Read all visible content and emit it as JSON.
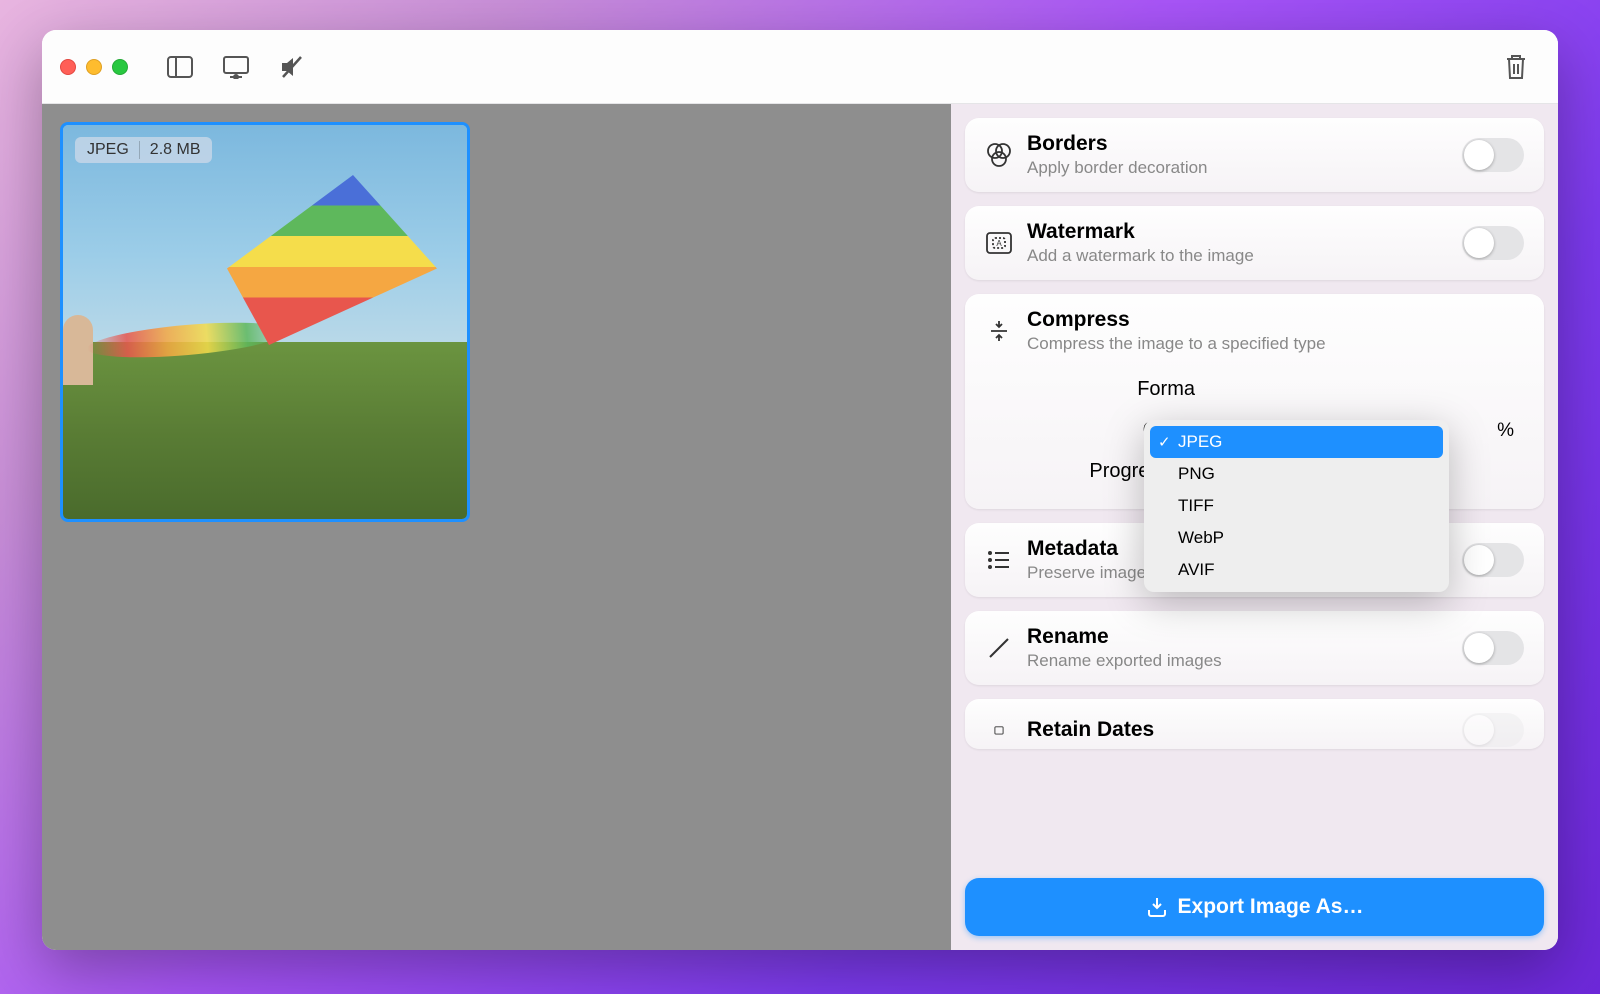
{
  "thumb": {
    "format": "JPEG",
    "size": "2.8 MB"
  },
  "sidebar": {
    "borders": {
      "title": "Borders",
      "sub": "Apply border decoration"
    },
    "watermark": {
      "title": "Watermark",
      "sub": "Add a watermark to the image"
    },
    "compress": {
      "title": "Compress",
      "sub": "Compress the image to a specified type",
      "format_label": "Forma",
      "quality_label": "Qualit",
      "quality_pct_suffix": "%",
      "progressive_label": "Progressive"
    },
    "metadata": {
      "title": "Metadata",
      "sub": "Preserve image metadata"
    },
    "rename": {
      "title": "Rename",
      "sub": "Rename exported images"
    },
    "retain": {
      "title": "Retain Dates"
    }
  },
  "dropdown": {
    "options": [
      "JPEG",
      "PNG",
      "TIFF",
      "WebP",
      "AVIF"
    ],
    "selected": "JPEG"
  },
  "export_label": "Export Image As…"
}
